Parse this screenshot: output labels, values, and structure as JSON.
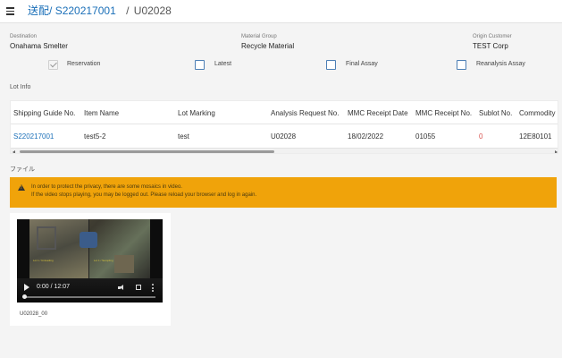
{
  "header": {
    "crumb_1": "送配/",
    "crumb_2": "S220217001",
    "crumb_sep": "/",
    "crumb_current": "U02028"
  },
  "fields": {
    "destination": {
      "label": "Destination",
      "value": "Onahama Smelter"
    },
    "material_group": {
      "label": "Material Group",
      "value": "Recycle Material"
    },
    "origin_customer": {
      "label": "Origin Customer",
      "value": "TEST Corp"
    }
  },
  "checks": [
    {
      "label": "Reservation",
      "checked": true
    },
    {
      "label": "Latest",
      "checked": false
    },
    {
      "label": "Final Assay",
      "checked": false
    },
    {
      "label": "Reanalysis Assay",
      "checked": false
    }
  ],
  "lot_info": {
    "title": "Lot Info",
    "columns": [
      "Shipping Guide No.",
      "Item Name",
      "Lot Marking",
      "Analysis Request No.",
      "MMC Receipt Date",
      "MMC Receipt No.",
      "Sublot No.",
      "Commodity"
    ],
    "row": [
      "S220217001",
      "test5-2",
      "test",
      "U02028",
      "18/02/2022",
      "01055",
      "0",
      "12E80101"
    ]
  },
  "files": {
    "title": "ファイル",
    "warning_line1": "In order to protect the privacy, there are some mosaics in video.",
    "warning_line2": "If the video stops playing, you may be logged out. Please reload your browser and log in again.",
    "video_time": "0:00 / 12:07",
    "video_caption": "U02028_00",
    "video_overlay_left": "Lot 1 / Unloading",
    "video_overlay_right": "Lot 1 / Sampling"
  },
  "colors": {
    "accent": "#1a6fb8",
    "warning": "#f0a30a",
    "sublot": "#d9534f"
  }
}
